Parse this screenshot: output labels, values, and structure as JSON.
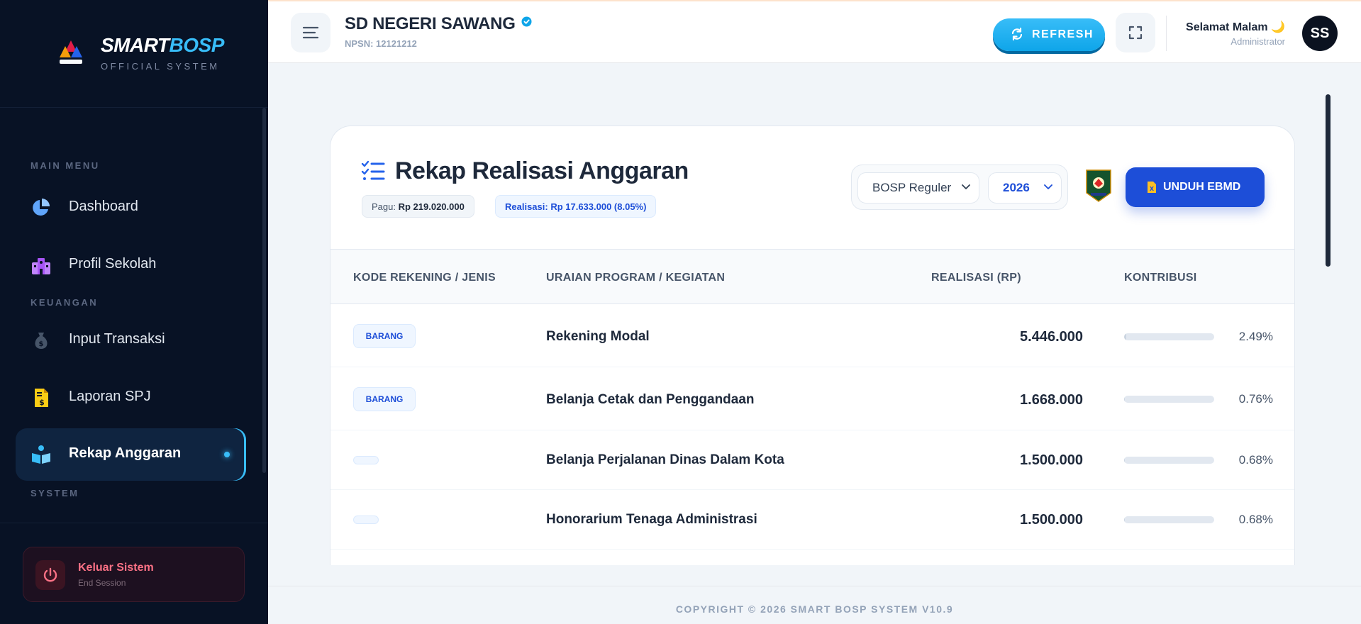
{
  "brand": {
    "name_part1": "SMART",
    "name_part2": "BOSP",
    "subtitle": "OFFICIAL SYSTEM",
    "logo_icon": "smartbosp-logo"
  },
  "sidebar": {
    "sections": {
      "main": "MAIN MENU",
      "finance": "KEUANGAN",
      "system": "SYSTEM"
    },
    "items": [
      {
        "label": "Dashboard",
        "icon": "pie-chart-icon"
      },
      {
        "label": "Profil Sekolah",
        "icon": "school-icon"
      },
      {
        "label": "Input Transaksi",
        "icon": "money-bag-icon"
      },
      {
        "label": "Laporan SPJ",
        "icon": "invoice-icon"
      },
      {
        "label": "Rekap Anggaran",
        "icon": "book-reader-icon",
        "active": true
      }
    ],
    "logout": {
      "title": "Keluar Sistem",
      "subtitle": "End Session",
      "icon": "power-icon"
    }
  },
  "topbar": {
    "school_name": "SD NEGERI SAWANG",
    "npsn": "NPSN: 12121212",
    "refresh_label": "REFRESH",
    "greeting": "Selamat Malam 🌙",
    "role": "Administrator",
    "avatar_initials": "SS"
  },
  "card": {
    "title": "Rekap Realisasi Anggaran",
    "pagu_label": "Pagu:",
    "pagu_value": "Rp 219.020.000",
    "realisasi": "Realisasi: Rp 17.633.000 (8.05%)",
    "program_select": "BOSP Reguler",
    "year_select": "2026",
    "download_label": "UNDUH EBMD"
  },
  "table": {
    "headers": [
      "KODE REKENING / JENIS",
      "URAIAN PROGRAM / KEGIATAN",
      "REALISASI (RP)",
      "KONTRIBUSI"
    ],
    "rows": [
      {
        "badge": "BARANG",
        "uraian": "Rekening Modal",
        "nilai": "5.446.000",
        "kontribusi": "2.49%",
        "fraction": 0.0249
      },
      {
        "badge": "BARANG",
        "uraian": "Belanja Cetak dan Penggandaan",
        "nilai": "1.668.000",
        "kontribusi": "0.76%",
        "fraction": 0.0076
      },
      {
        "badge": "",
        "uraian": "Belanja Perjalanan Dinas Dalam Kota",
        "nilai": "1.500.000",
        "kontribusi": "0.68%",
        "fraction": 0.0068
      },
      {
        "badge": "",
        "uraian": "Honorarium Tenaga Administrasi",
        "nilai": "1.500.000",
        "kontribusi": "0.68%",
        "fraction": 0.0068
      }
    ]
  },
  "footer": {
    "copyright": "COPYRIGHT © 2026 SMART BOSP SYSTEM V10.9"
  },
  "colors": {
    "accent": "#38bdf8",
    "primary": "#1d4ed8",
    "sidebar": "#081225",
    "danger": "#fb7185"
  }
}
